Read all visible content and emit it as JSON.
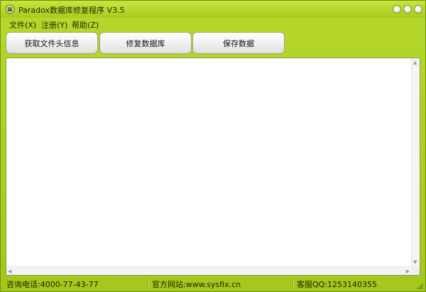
{
  "window": {
    "title": "Paradox数据库修复程序 V3.5",
    "icons": {
      "app": "database-repair-icon",
      "minimize": "minimize-icon",
      "maximize": "maximize-icon",
      "close": "close-icon"
    }
  },
  "menu": {
    "items": [
      "文件(X)",
      "注册(Y)",
      "帮助(Z)"
    ]
  },
  "toolbar": {
    "read_header_label": "获取文件头信息",
    "repair_db_label": "修复数据库",
    "save_data_label": "保存数据"
  },
  "content": {
    "text": ""
  },
  "status": {
    "phone": "咨询电话:4000-77-43-77",
    "website": "官方网站:www.sysfix.cn",
    "qq": "客服QQ:1253140355"
  },
  "colors": {
    "frame": "#a3c71c",
    "title_bar": "#c6e63e",
    "button_face": "#f2f2f2",
    "content_bg": "#ffffff"
  }
}
